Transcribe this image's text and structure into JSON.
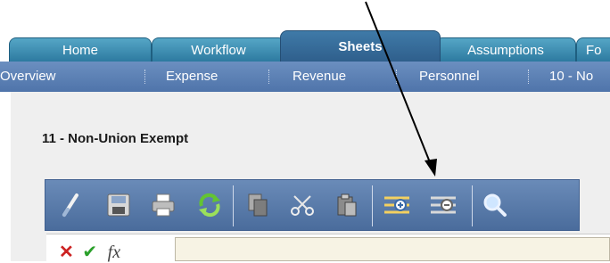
{
  "tabs": [
    "Home",
    "Workflow",
    "Sheets",
    "Assumptions",
    "Fo"
  ],
  "active_tab": "Sheets",
  "subnav": [
    "Overview",
    "Expense",
    "Revenue",
    "Personnel",
    "10 - No"
  ],
  "section_title": "11 - Non-Union Exempt",
  "toolbar_icons": [
    "brush-icon",
    "save-icon",
    "print-icon",
    "refresh-icon",
    "copy-icon",
    "cut-icon",
    "paste-icon",
    "expand-rows-icon",
    "collapse-rows-icon",
    "search-icon"
  ],
  "formula_bar": {
    "cancel": "✕",
    "confirm": "✔",
    "fx": "fx",
    "value": ""
  }
}
